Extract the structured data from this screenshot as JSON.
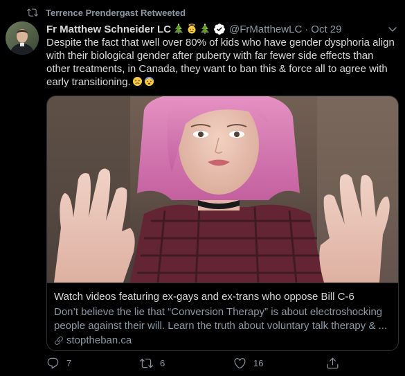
{
  "retweet": {
    "icon": "retweet-icon",
    "label": "Terrence Prendergast Retweeted"
  },
  "author": {
    "avatar": "profile-photo",
    "display_name": "Fr Matthew Schneider LC",
    "name_emojis": [
      "christmas-tree-emoji",
      "angel-emoji",
      "christmas-tree-emoji"
    ],
    "verified": true,
    "handle": "@FrMatthewLC",
    "separator": "·",
    "date": "Oct 29"
  },
  "tweet": {
    "text": "Despite the fact that well over 80% of kids who have gender dysphoria align with their biological gender after puberty with far fewer side effects than other treatments, in Canada, they want to ban this & force all to agree with early transitioning.",
    "trailing_emojis": [
      "worried-face-emoji",
      "fearful-face-emoji"
    ]
  },
  "card": {
    "image": "woman-pink-hair-hands-on-glass-photo",
    "title": "Watch videos featuring ex-gays and ex-trans who oppose Bill C-6",
    "description": "Don’t believe the lie that “Conversion Therapy” is about electroshocking people against their will. Learn the truth about voluntary talk therapy & ...",
    "domain": "stoptheban.ca"
  },
  "actions": {
    "reply_count": "7",
    "retweet_count": "6",
    "like_count": "16"
  },
  "colors": {
    "background": "#000000",
    "text": "#d9d9d9",
    "secondary": "#8b98a5",
    "border": "#2f3336",
    "verified": "#ffffff"
  }
}
